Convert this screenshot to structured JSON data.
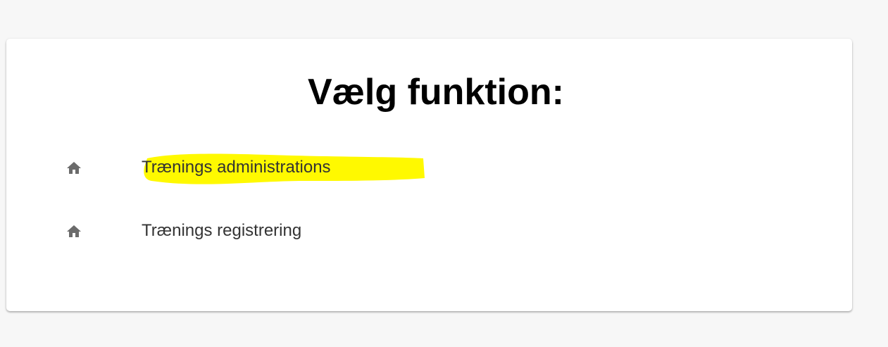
{
  "page": {
    "background": "#f7f7f7"
  },
  "card": {
    "title": "Vælg funktion:",
    "background": "#ffffff"
  },
  "menu": {
    "items": [
      {
        "label": "Trænings administrations",
        "icon": "home-icon",
        "highlighted": true,
        "highlight_color": "#fff900"
      },
      {
        "label": "Trænings registrering",
        "icon": "home-icon",
        "highlighted": false
      }
    ]
  }
}
